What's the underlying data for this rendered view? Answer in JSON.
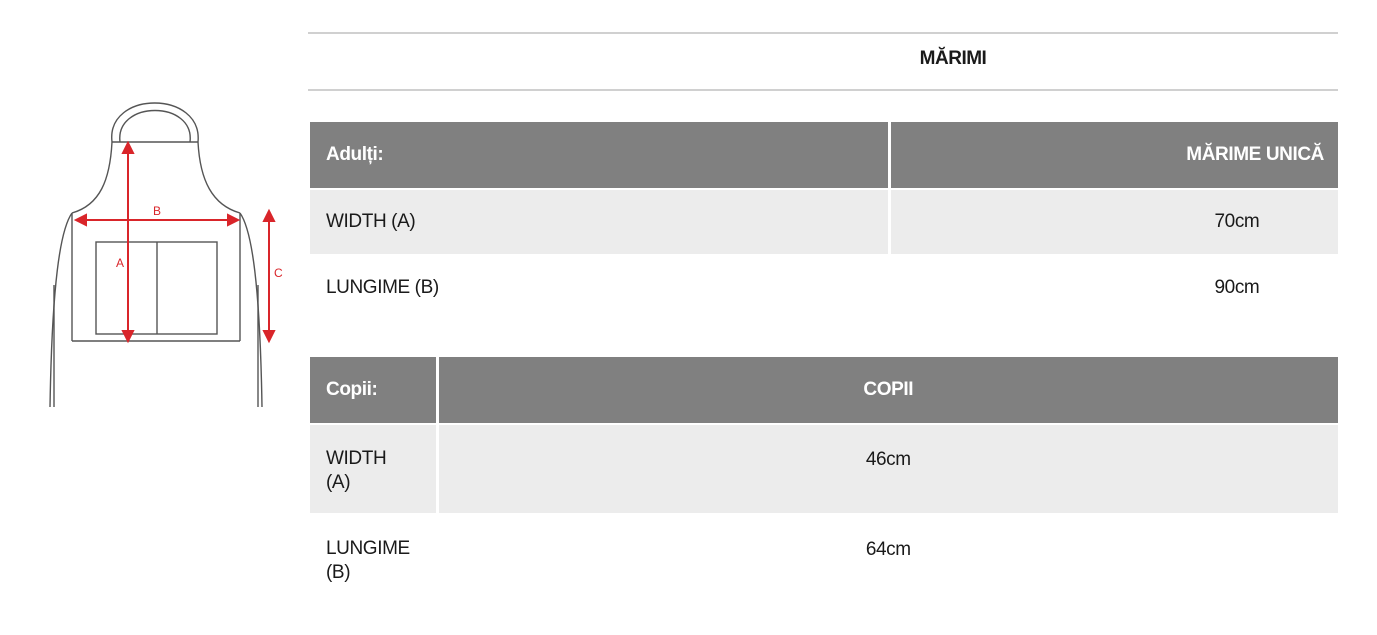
{
  "diagram": {
    "label_a": "A",
    "label_b": "B",
    "label_c": "C",
    "arrow_color": "#d9252a",
    "outline_color": "#555555"
  },
  "title": "MĂRIMI",
  "adults": {
    "header_label": "Adulți:",
    "header_size": "MĂRIME UNICĂ",
    "rows": [
      {
        "label": "WIDTH (A)",
        "value": "70cm"
      },
      {
        "label": "LUNGIME (B)",
        "value": "90cm"
      }
    ]
  },
  "children": {
    "header_label": "Copii:",
    "header_size": "COPII",
    "rows": [
      {
        "label_line1": "WIDTH",
        "label_line2": "(A)",
        "value": "46cm"
      },
      {
        "label_line1": "LUNGIME",
        "label_line2": "(B)",
        "value": "64cm"
      }
    ]
  },
  "colors": {
    "header_bg": "#808080",
    "shaded_row": "#ececec",
    "rule": "#d0d0d0"
  }
}
